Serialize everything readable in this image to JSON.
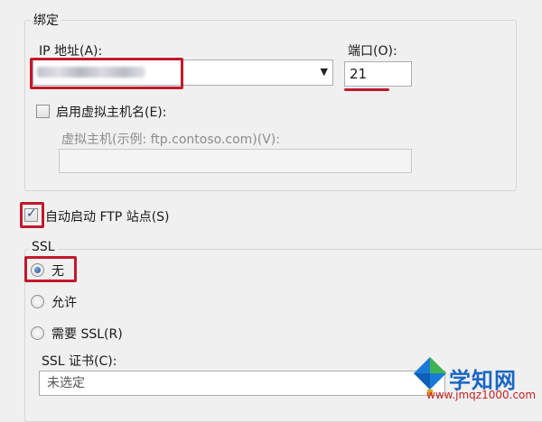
{
  "binding": {
    "group_title": "绑定",
    "ip_label": "IP 地址(A):",
    "port_label": "端口(O):",
    "port_value": "21",
    "enable_virtual_host_label": "启用虚拟主机名(E):",
    "virtual_host_label": "虚拟主机(示例: ftp.contoso.com)(V):",
    "virtual_host_value": ""
  },
  "auto_start": {
    "label": "自动启动 FTP 站点(S)",
    "checked": true
  },
  "ssl": {
    "group_title": "SSL",
    "options": [
      {
        "label": "无",
        "selected": true
      },
      {
        "label": "允许",
        "selected": false
      },
      {
        "label": "需要 SSL(R)",
        "selected": false
      }
    ],
    "cert_label": "SSL 证书(C):",
    "cert_value": "未选定"
  },
  "watermark": {
    "title": "学知网",
    "url": "www.jmqz1000.com"
  },
  "colors": {
    "highlight": "#c3182b",
    "window_bg": "#f0f0f0"
  }
}
